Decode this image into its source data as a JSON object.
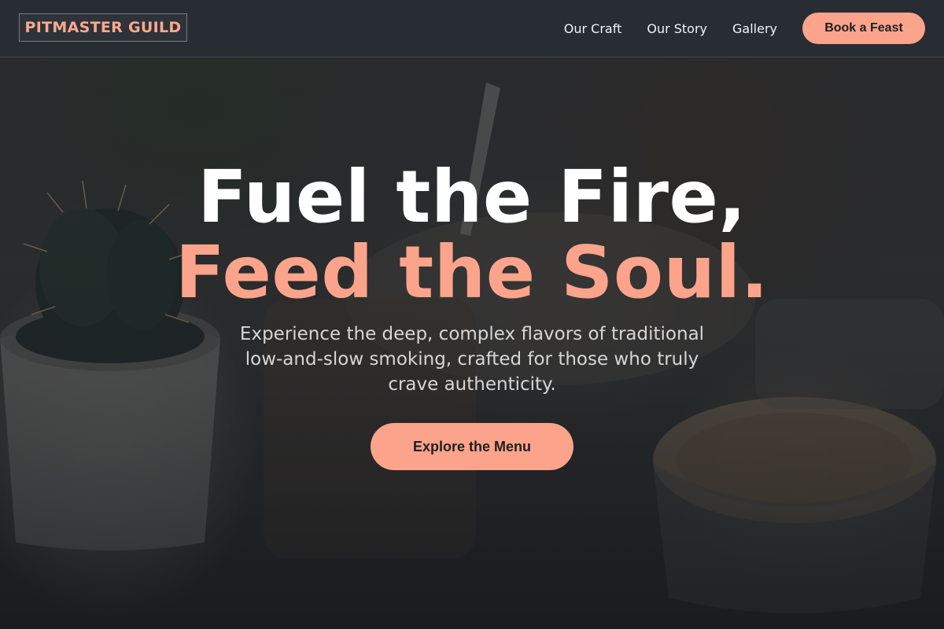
{
  "header": {
    "logo": "PITMASTER GUILD",
    "nav": [
      {
        "label": "Our Craft"
      },
      {
        "label": "Our Story"
      },
      {
        "label": "Gallery"
      }
    ],
    "cta_label": "Book a Feast"
  },
  "hero": {
    "headline_line1": "Fuel the Fire,",
    "headline_line2": "Feed the Soul.",
    "subtext": "Experience the deep, complex flavors of traditional low-and-slow smoking, crafted for those who truly crave authenticity.",
    "cta_label": "Explore the Menu"
  },
  "colors": {
    "accent": "#fba48b",
    "header_bg": "#2e3338",
    "headline": "#ffffff",
    "subtext": "#d6d6d6"
  }
}
